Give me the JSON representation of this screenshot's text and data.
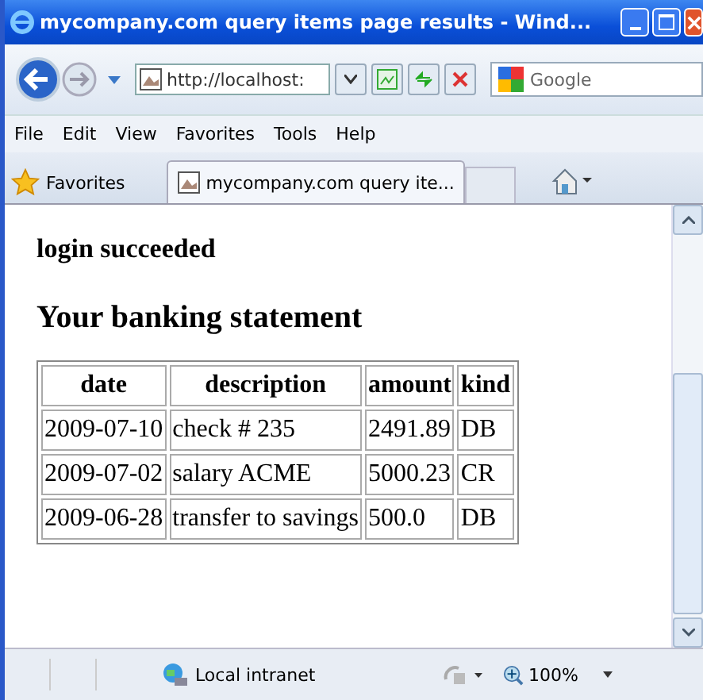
{
  "window": {
    "title": "mycompany.com query items page results - Wind..."
  },
  "address_bar": {
    "value": "http://localhost:"
  },
  "search": {
    "value": "Google"
  },
  "menu": [
    "File",
    "Edit",
    "View",
    "Favorites",
    "Tools",
    "Help"
  ],
  "favorites_bar": {
    "label": "Favorites",
    "tab": "mycompany.com query ite..."
  },
  "page": {
    "message": "login succeeded",
    "heading": "Your banking statement",
    "table": {
      "columns": [
        "date",
        "description",
        "amount",
        "kind"
      ],
      "rows": [
        [
          "2009-07-10",
          "check # 235",
          "2491.89",
          "DB"
        ],
        [
          "2009-07-02",
          "salary ACME",
          "5000.23",
          "CR"
        ],
        [
          "2009-06-28",
          "transfer to savings",
          "500.0",
          "DB"
        ]
      ]
    }
  },
  "status_bar": {
    "zone": "Local intranet",
    "zoom": "100%"
  }
}
